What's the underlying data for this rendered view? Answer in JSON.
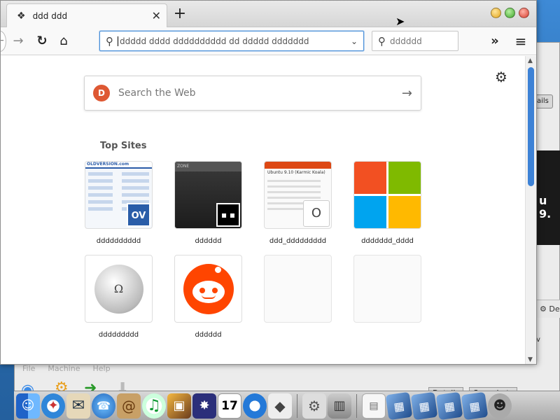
{
  "browser": {
    "tab_title": "ddd ddd",
    "tab_close": "✕",
    "new_tab": "+",
    "url_placeholder": "ddddd dddd dddddddddd dd ddddd ddddddd",
    "search_placeholder": "dddddd",
    "back": "←",
    "forward": "→",
    "reload": "↻",
    "home": "⌂",
    "overflow": "»",
    "menu": "≡",
    "url_dropdown": "⌄"
  },
  "newtab": {
    "web_search_placeholder": "Search the Web",
    "web_search_engine_letter": "D",
    "top_sites_title": "Top Sites",
    "sites": [
      {
        "label": "dddddddddd",
        "badge": "OV",
        "thumb_header": "OLDVERSION.com"
      },
      {
        "label": "dddddd",
        "thumb_header": "ZONE"
      },
      {
        "label": "ddd_ddddddddd",
        "badge": "O",
        "thumb_title": "Ubuntu 9.10 (Karmic Koala)"
      },
      {
        "label": "ddddddd_dddd"
      },
      {
        "label": "ddddddddd",
        "badge": "Ω"
      },
      {
        "label": "dddddd"
      },
      {
        "label": ""
      },
      {
        "label": ""
      }
    ]
  },
  "background": {
    "menu": [
      "File",
      "Machine",
      "Help"
    ],
    "panel_text": "u 9.",
    "details_label": "ails",
    "right_list_item": "De",
    "right_list_v": "v",
    "status_buttons": [
      "Details",
      "Snapshots"
    ]
  },
  "dock": {
    "calendar_day": "17"
  },
  "colors": {
    "url_focus": "#4a90d9",
    "scroll_thumb": "#3d82d6",
    "ddg": "#de5833",
    "reddit": "#ff4500"
  }
}
